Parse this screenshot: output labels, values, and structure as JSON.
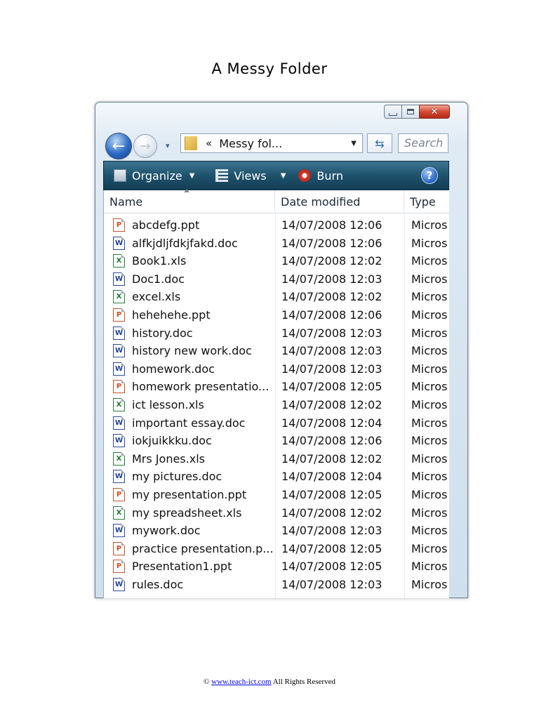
{
  "page": {
    "title": "A Messy Folder"
  },
  "window": {
    "close_glyph": "✕",
    "address": {
      "chevron": "«",
      "path": "Messy fol...",
      "dropdown_glyph": "▼"
    },
    "refresh_glyph": "⇆",
    "search_placeholder": "Search",
    "nav": {
      "back_glyph": "←",
      "forward_glyph": "→",
      "history_glyph": "▾"
    },
    "toolbar": {
      "organize_label": "Organize",
      "views_label": "Views",
      "burn_label": "Burn",
      "dropdown_glyph": "▼",
      "help_glyph": "?"
    },
    "columns": {
      "name": "Name",
      "date": "Date modified",
      "type": "Type"
    },
    "files": [
      {
        "name": "abcdefg.ppt",
        "date": "14/07/2008 12:06",
        "type": "Micros",
        "icon": "ppt-icon",
        "glyph": "P"
      },
      {
        "name": "alfkjdljfdkjfakd.doc",
        "date": "14/07/2008 12:06",
        "type": "Micros",
        "icon": "doc-icon",
        "glyph": "W"
      },
      {
        "name": "Book1.xls",
        "date": "14/07/2008 12:02",
        "type": "Micros",
        "icon": "xls-icon",
        "glyph": "X"
      },
      {
        "name": "Doc1.doc",
        "date": "14/07/2008 12:03",
        "type": "Micros",
        "icon": "doc-icon",
        "glyph": "W"
      },
      {
        "name": "excel.xls",
        "date": "14/07/2008 12:02",
        "type": "Micros",
        "icon": "xls-icon",
        "glyph": "X"
      },
      {
        "name": "hehehehe.ppt",
        "date": "14/07/2008 12:06",
        "type": "Micros",
        "icon": "ppt-icon",
        "glyph": "P"
      },
      {
        "name": "history.doc",
        "date": "14/07/2008 12:03",
        "type": "Micros",
        "icon": "doc-icon",
        "glyph": "W"
      },
      {
        "name": "history new work.doc",
        "date": "14/07/2008 12:03",
        "type": "Micros",
        "icon": "doc-icon",
        "glyph": "W"
      },
      {
        "name": "homework.doc",
        "date": "14/07/2008 12:03",
        "type": "Micros",
        "icon": "doc-icon",
        "glyph": "W"
      },
      {
        "name": "homework presentatio...",
        "date": "14/07/2008 12:05",
        "type": "Micros",
        "icon": "ppt-icon",
        "glyph": "P"
      },
      {
        "name": "ict lesson.xls",
        "date": "14/07/2008 12:02",
        "type": "Micros",
        "icon": "xls-icon",
        "glyph": "X"
      },
      {
        "name": "important essay.doc",
        "date": "14/07/2008 12:04",
        "type": "Micros",
        "icon": "doc-icon",
        "glyph": "W"
      },
      {
        "name": "iokjuikkku.doc",
        "date": "14/07/2008 12:06",
        "type": "Micros",
        "icon": "doc-icon",
        "glyph": "W"
      },
      {
        "name": "Mrs Jones.xls",
        "date": "14/07/2008 12:02",
        "type": "Micros",
        "icon": "xls-icon",
        "glyph": "X"
      },
      {
        "name": "my pictures.doc",
        "date": "14/07/2008 12:04",
        "type": "Micros",
        "icon": "doc-icon",
        "glyph": "W"
      },
      {
        "name": "my presentation.ppt",
        "date": "14/07/2008 12:05",
        "type": "Micros",
        "icon": "ppt-icon",
        "glyph": "P"
      },
      {
        "name": "my spreadsheet.xls",
        "date": "14/07/2008 12:02",
        "type": "Micros",
        "icon": "xls-icon",
        "glyph": "X"
      },
      {
        "name": "mywork.doc",
        "date": "14/07/2008 12:03",
        "type": "Micros",
        "icon": "doc-icon",
        "glyph": "W"
      },
      {
        "name": "practice presentation.p...",
        "date": "14/07/2008 12:05",
        "type": "Micros",
        "icon": "ppt-icon",
        "glyph": "P"
      },
      {
        "name": "Presentation1.ppt",
        "date": "14/07/2008 12:05",
        "type": "Micros",
        "icon": "ppt-icon",
        "glyph": "P"
      },
      {
        "name": "rules.doc",
        "date": "14/07/2008 12:03",
        "type": "Micros",
        "icon": "doc-icon",
        "glyph": "W"
      }
    ]
  },
  "footer": {
    "copyright": "©",
    "link": "www.teach-ict.com",
    "rights": "All Rights Reserved"
  },
  "colors": {
    "toolbar": "#1f526c",
    "link": "#0000ee",
    "ppt": "#d24b1c",
    "doc": "#1f3f96",
    "xls": "#1f7a2e"
  }
}
